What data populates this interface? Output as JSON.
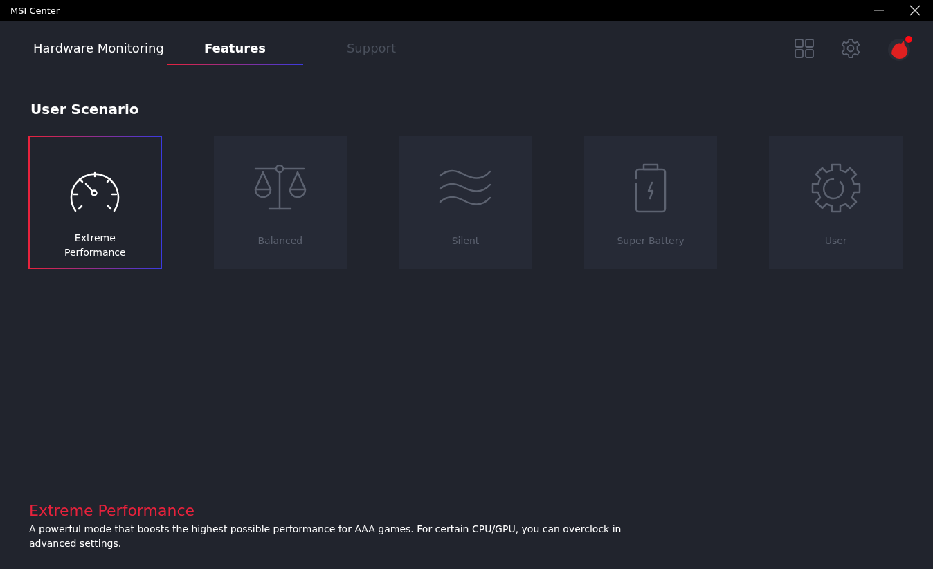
{
  "window": {
    "title": "MSI Center"
  },
  "tabs": [
    {
      "label": "Hardware Monitoring",
      "selected": false,
      "disabled": false
    },
    {
      "label": "Features",
      "selected": true,
      "disabled": false
    },
    {
      "label": "Support",
      "selected": false,
      "disabled": true
    }
  ],
  "section": {
    "title": "User Scenario"
  },
  "scenarios": [
    {
      "kind": "speedometer",
      "label": "Extreme\nPerformance",
      "selected": true
    },
    {
      "kind": "scale",
      "label": "Balanced",
      "selected": false
    },
    {
      "kind": "waves",
      "label": "Silent",
      "selected": false
    },
    {
      "kind": "battery",
      "label": "Super Battery",
      "selected": false
    },
    {
      "kind": "gear",
      "label": "User",
      "selected": false
    }
  ],
  "description": {
    "title": "Extreme Performance",
    "text": "A powerful mode that boosts the highest possible performance for AAA games. For certain CPU/GPU, you can overclock in advanced settings."
  }
}
